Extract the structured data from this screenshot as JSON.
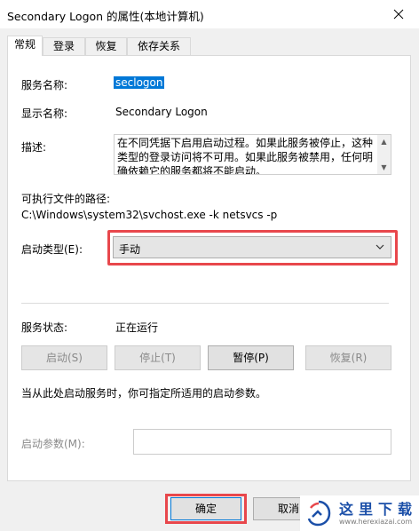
{
  "window": {
    "title": "Secondary Logon 的属性(本地计算机)"
  },
  "tabs": [
    {
      "label": "常规",
      "active": true
    },
    {
      "label": "登录",
      "active": false
    },
    {
      "label": "恢复",
      "active": false
    },
    {
      "label": "依存关系",
      "active": false
    }
  ],
  "general": {
    "service_name_label": "服务名称:",
    "service_name_value": "seclogon",
    "display_name_label": "显示名称:",
    "display_name_value": "Secondary Logon",
    "description_label": "描述:",
    "description_value": "在不同凭据下启用启动过程。如果此服务被停止，这种类型的登录访问将不可用。如果此服务被禁用，任何明确依赖它的服务都将不能启动。",
    "exe_path_label": "可执行文件的路径:",
    "exe_path_value": "C:\\Windows\\system32\\svchost.exe -k netsvcs -p",
    "startup_type_label": "启动类型(E):",
    "startup_type_value": "手动",
    "status_label": "服务状态:",
    "status_value": "正在运行",
    "buttons": {
      "start": "启动(S)",
      "stop": "停止(T)",
      "pause": "暂停(P)",
      "resume": "恢复(R)"
    },
    "hint": "当从此处启动服务时，你可指定所适用的启动参数。",
    "start_params_label": "启动参数(M):",
    "start_params_value": ""
  },
  "footer": {
    "ok": "确定",
    "cancel": "取消"
  },
  "watermark": {
    "text": "这里下载",
    "url": "www.herexiazai.com"
  },
  "colors": {
    "selection": "#0078d7",
    "highlight_outline": "#e8474c",
    "watermark": "#1b4fa8"
  }
}
